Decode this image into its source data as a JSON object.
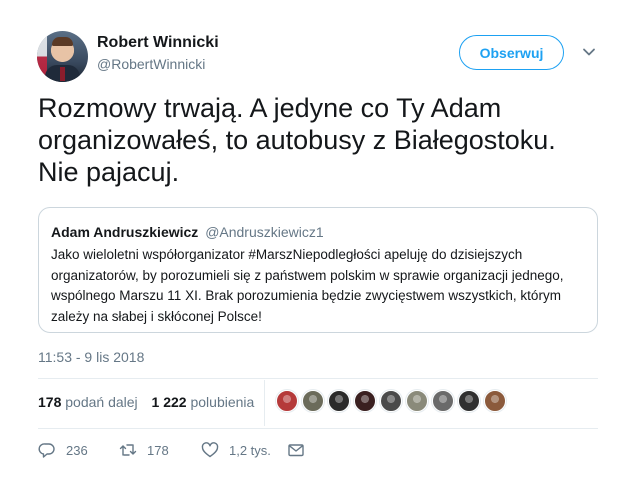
{
  "author": {
    "name": "Robert Winnicki",
    "handle": "@RobertWinnicki",
    "follow_label": "Obserwuj"
  },
  "tweet": {
    "text": "Rozmowy trwają. A jedyne co Ty Adam organizowałeś, to autobusy z Białegostoku. Nie pajacuj.",
    "timestamp": "11:53 - 9 lis 2018"
  },
  "quote": {
    "name": "Adam Andruszkiewicz",
    "handle": "@Andruszkiewicz1",
    "text": "Jako wieloletni współorganizator #MarszNiepodległości apeluję do dzisiejszych organizatorów, by  porozumieli się z państwem polskim w sprawie organizacji jednego, wspólnego Marszu 11 XI. Brak porozumienia będzie zwycięstwem wszystkich, którym zależy na słabej i skłóconej Polsce!"
  },
  "stats": {
    "retweets_count": "178",
    "retweets_label": "podań dalej",
    "likes_count": "1 222",
    "likes_label": "polubienia"
  },
  "likers": [
    "#b53a3a",
    "#6b6b5a",
    "#2a2a2a",
    "#3a2020",
    "#4a4a4a",
    "#8a8a7a",
    "#6a6a6a",
    "#303030",
    "#8b5a3c"
  ],
  "actions": {
    "reply_count": "236",
    "retweet_count": "178",
    "like_count": "1,2 tys."
  },
  "colors": {
    "accent": "#1da1f2",
    "secondary_text": "#657786",
    "border": "#ccd6dd"
  }
}
